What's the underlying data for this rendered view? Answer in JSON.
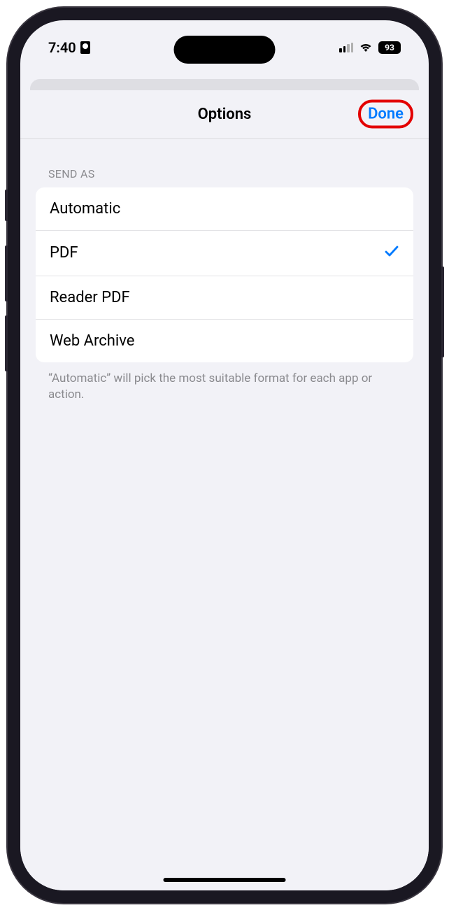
{
  "status": {
    "time": "7:40",
    "battery_level": "93"
  },
  "modal": {
    "title": "Options",
    "done_label": "Done"
  },
  "section": {
    "header": "SEND AS",
    "items": [
      {
        "label": "Automatic",
        "selected": false
      },
      {
        "label": "PDF",
        "selected": true
      },
      {
        "label": "Reader PDF",
        "selected": false
      },
      {
        "label": "Web Archive",
        "selected": false
      }
    ],
    "footer": "“Automatic” will pick the most suitable format for each app or action."
  }
}
